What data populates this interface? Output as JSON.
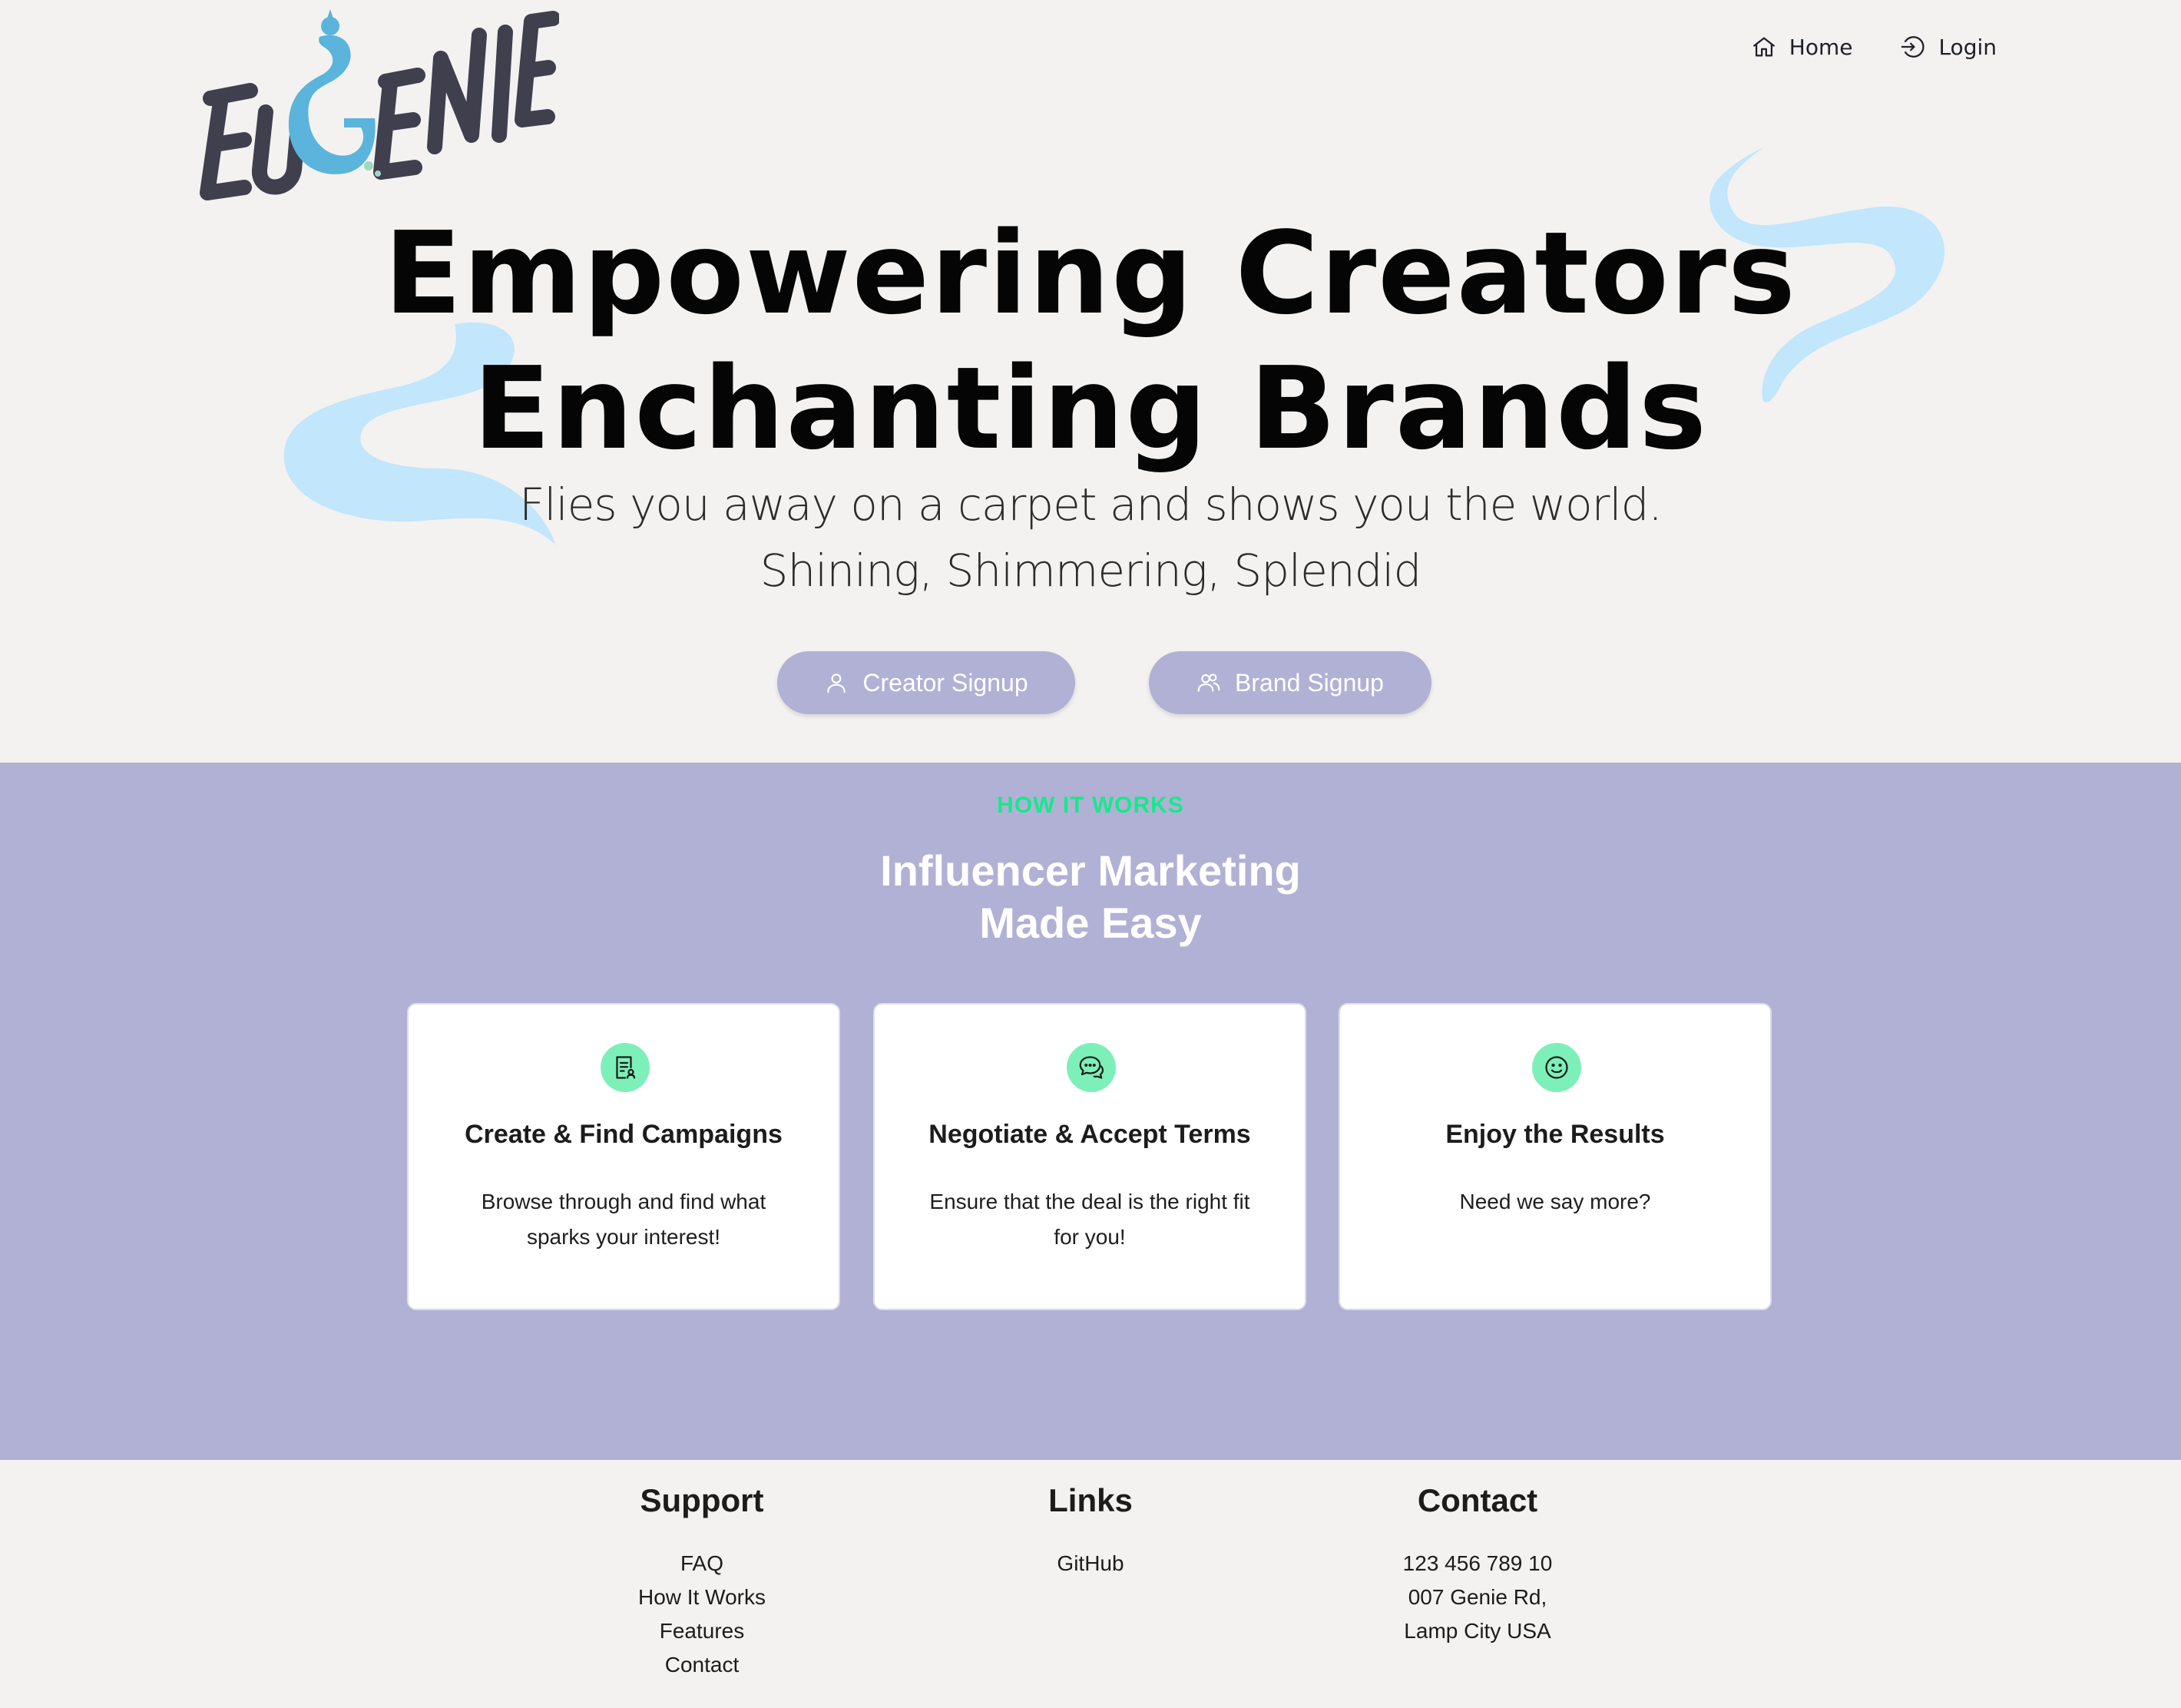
{
  "brand": {
    "logo_text": "EUGENIE",
    "colors": {
      "accent": "#b1b1d6",
      "highlight": "#17e88a",
      "icon_bg": "#7df0b9",
      "swirl": "#c2e6fb",
      "logo_dark": "#3f3f4e",
      "logo_blue": "#5ab4dc"
    }
  },
  "nav": {
    "home": {
      "label": "Home",
      "icon": "home-icon"
    },
    "login": {
      "label": "Login",
      "icon": "login-icon"
    }
  },
  "hero": {
    "headline_1": "Empowering Creators",
    "headline_2": "Enchanting Brands",
    "tagline_1": "Flies you away on a carpet and shows you the world.",
    "tagline_2": "Shining, Shimmering, Splendid",
    "creator_signup": {
      "label": "Creator Signup",
      "icon": "user-icon"
    },
    "brand_signup": {
      "label": "Brand Signup",
      "icon": "users-icon"
    }
  },
  "how_it_works": {
    "eyebrow": "HOW IT WORKS",
    "title_1": "Influencer Marketing",
    "title_2": "Made Easy",
    "cards": [
      {
        "icon": "document-user-icon",
        "title": "Create & Find Campaigns",
        "text": "Browse through and find what sparks your interest!"
      },
      {
        "icon": "chat-bubbles-icon",
        "title": "Negotiate & Accept Terms",
        "text": "Ensure that the deal is the right fit for you!"
      },
      {
        "icon": "smile-icon",
        "title": "Enjoy the Results",
        "text": "Need we say more?"
      }
    ]
  },
  "footer": {
    "support": {
      "title": "Support",
      "links": [
        "FAQ",
        "How It Works",
        "Features",
        "Contact"
      ]
    },
    "links": {
      "title": "Links",
      "links": [
        "GitHub"
      ]
    },
    "contact": {
      "title": "Contact",
      "lines": [
        "123 456 789 10",
        "007 Genie Rd,",
        "Lamp City USA"
      ]
    }
  }
}
